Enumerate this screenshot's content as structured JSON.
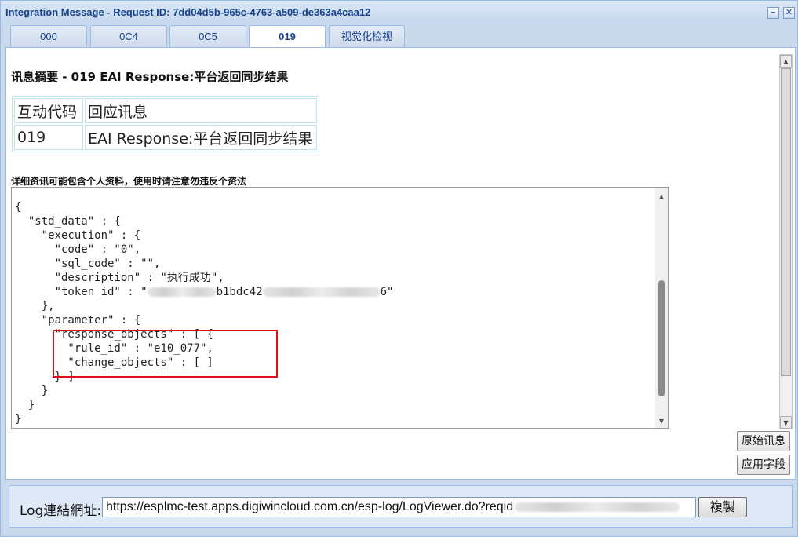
{
  "window": {
    "title": "Integration Message - Request ID: 7dd04d5b-965c-4763-a509-de363a4caa12",
    "minimize_icon": "minimize-icon",
    "close_icon": "close-icon"
  },
  "tabs": [
    {
      "label": "000",
      "active": false
    },
    {
      "label": "0C4",
      "active": false
    },
    {
      "label": "0C5",
      "active": false
    },
    {
      "label": "019",
      "active": true
    },
    {
      "label": "视觉化检视",
      "active": false
    }
  ],
  "summary": {
    "title": "讯息摘要 - 019 EAI Response:平台返回同步结果",
    "table": [
      [
        "互动代码",
        "回应讯息"
      ],
      [
        "019",
        "EAI Response:平台返回同步结果"
      ]
    ]
  },
  "warning": "详细资讯可能包含个人资料，使用时请注意勿违反个资法",
  "code": {
    "line1": "{",
    "line2": "  \"std_data\" : {",
    "line3": "    \"execution\" : {",
    "line4": "      \"code\" : \"0\",",
    "line5": "      \"sql_code\" : \"\",",
    "line6": "      \"description\" : \"执行成功\",",
    "line7_prefix": "      \"token_id\" : \"",
    "line7_visible": "b1bdc42",
    "line7_suffix": "6\"",
    "line8": "    },",
    "line9": "    \"parameter\" : {",
    "line10": "      \"response_objects\" : [ {",
    "line11": "        \"rule_id\" : \"e10_077\",",
    "line12": "        \"change_objects\" : [ ]",
    "line13": "      } ]",
    "line14": "    }",
    "line15": "  }",
    "line16": "}"
  },
  "buttons": {
    "raw_message": "原始讯息",
    "apply_fields": "应用字段",
    "copy": "複製"
  },
  "log": {
    "label": "Log連結網址:",
    "url": "https://esplmc-test.apps.digiwincloud.com.cn/esp-log/LogViewer.do?reqid"
  }
}
